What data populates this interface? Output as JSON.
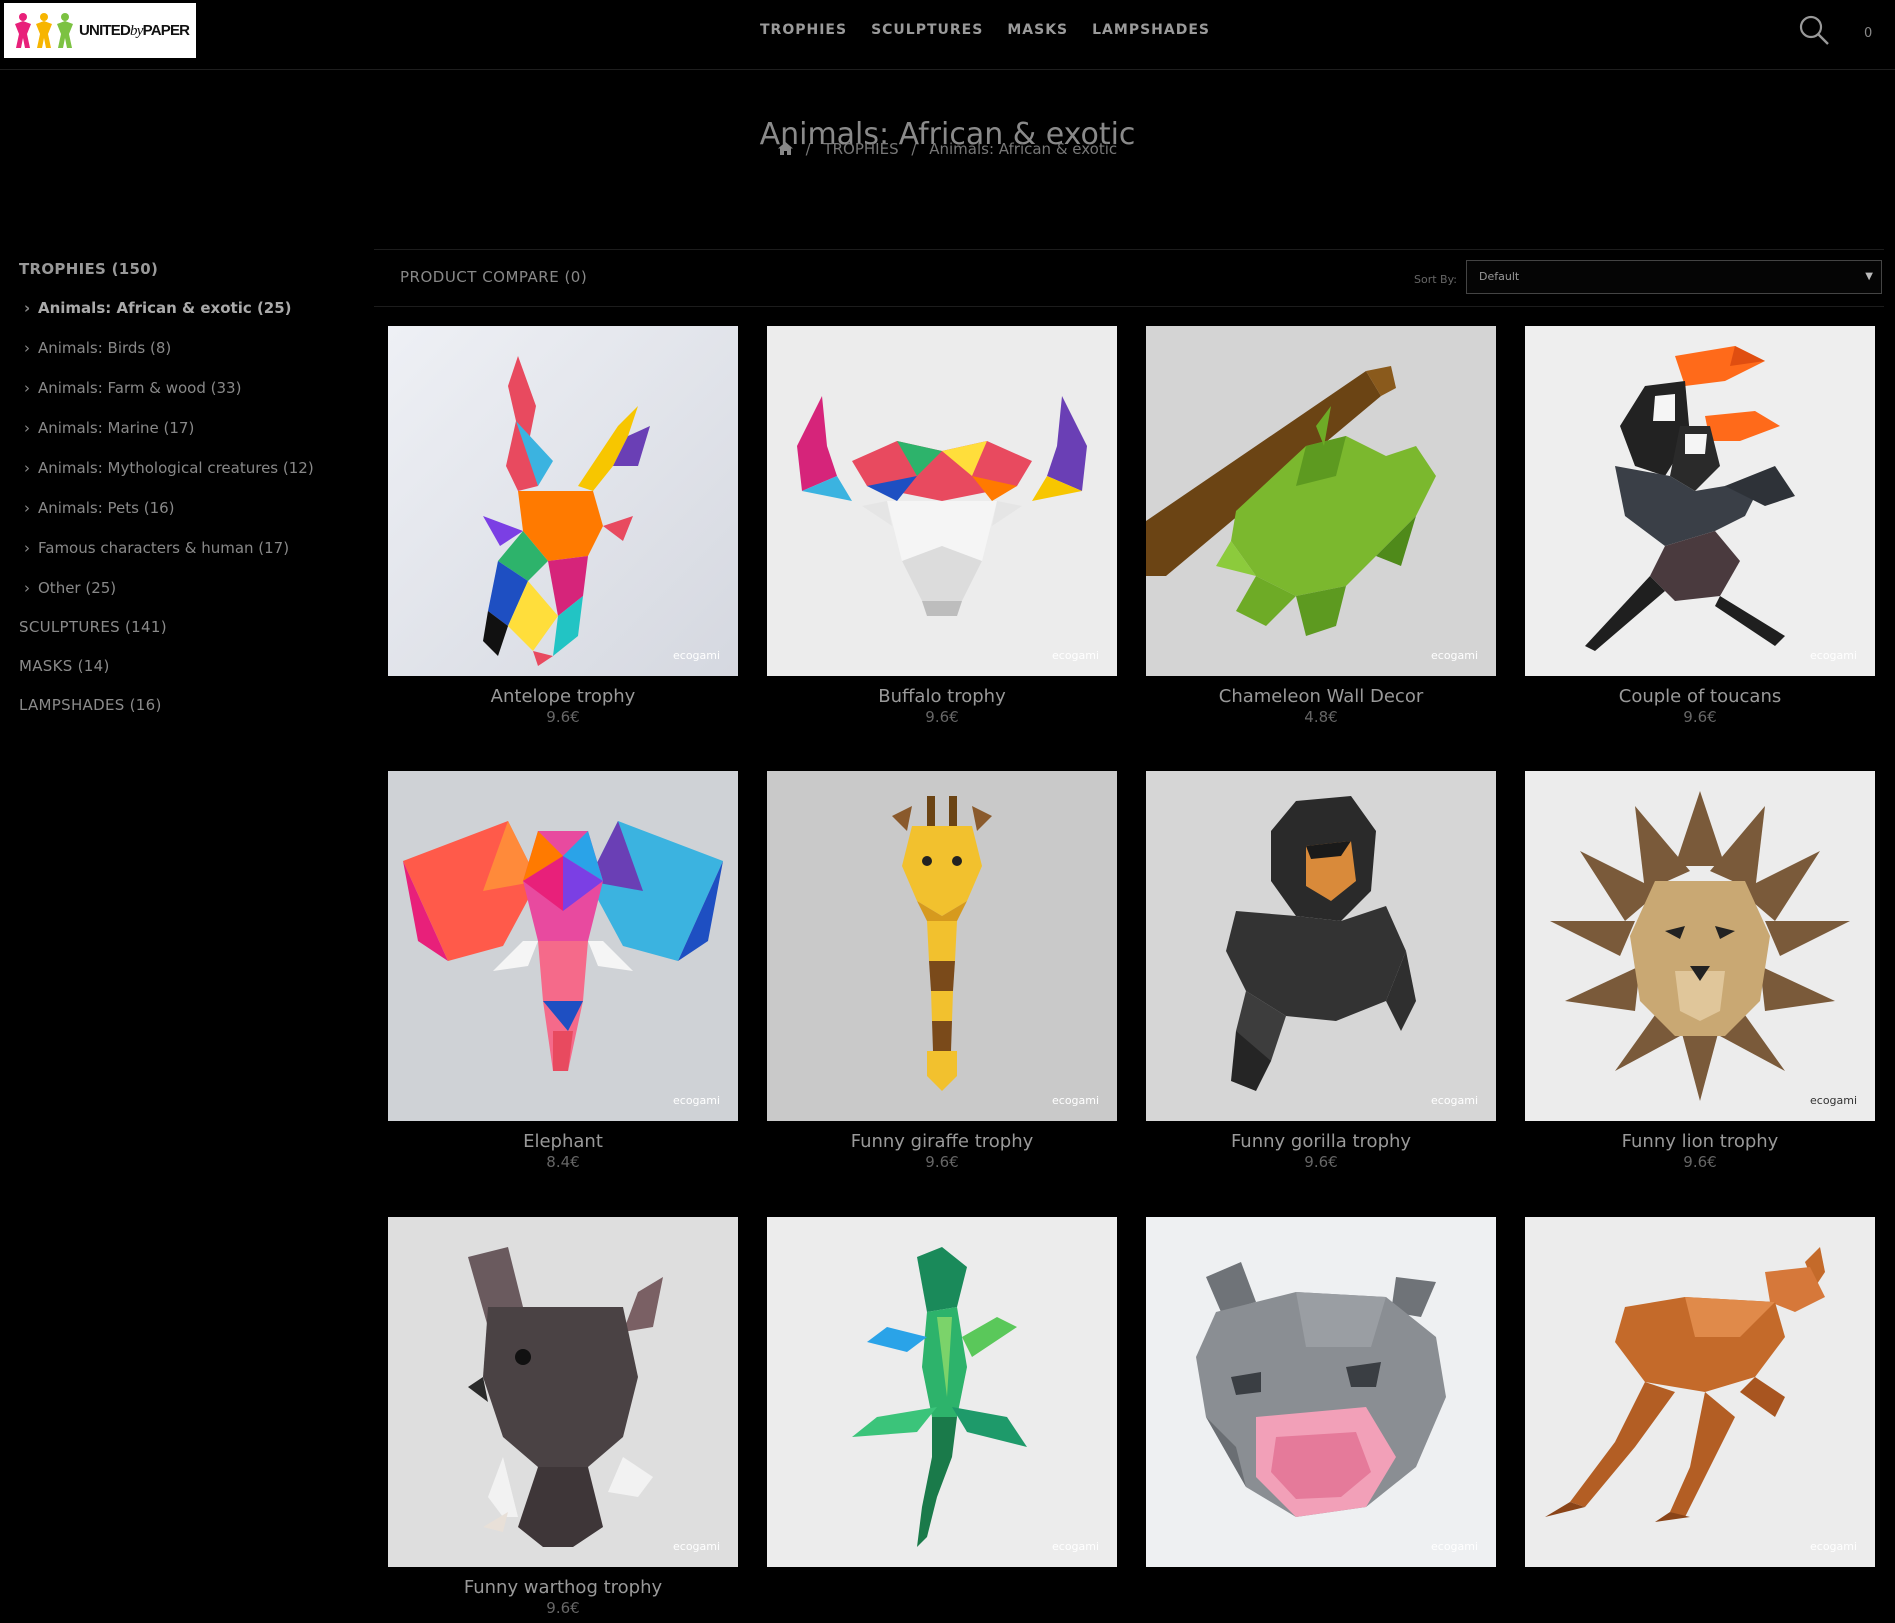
{
  "header": {
    "logo_text_bold": "UNITED",
    "logo_text_italic": "by",
    "logo_text_end": "PAPER",
    "nav": [
      "TROPHIES",
      "SCULPTURES",
      "MASKS",
      "LAMPSHADES"
    ],
    "cart_count": "0"
  },
  "page": {
    "title": "Animals: African & exotic",
    "breadcrumb": [
      "TROPHIES",
      "Animals: African & exotic"
    ]
  },
  "sidebar": {
    "top": [
      {
        "label": "TROPHIES (150)"
      },
      {
        "label": "SCULPTURES (141)"
      },
      {
        "label": "MASKS (14)"
      },
      {
        "label": "LAMPSHADES (16)"
      }
    ],
    "subs": [
      {
        "label": "Animals: African & exotic (25)"
      },
      {
        "label": "Animals: Birds (8)"
      },
      {
        "label": "Animals: Farm & wood (33)"
      },
      {
        "label": "Animals: Marine (17)"
      },
      {
        "label": "Animals: Mythological creatures (12)"
      },
      {
        "label": "Animals: Pets (16)"
      },
      {
        "label": "Famous characters & human (17)"
      },
      {
        "label": "Other (25)"
      }
    ]
  },
  "toolbar": {
    "compare": "PRODUCT COMPARE (0)",
    "sort_label": "Sort By:",
    "sort_value": "Default"
  },
  "watermark": "ecogami",
  "products": [
    {
      "name": "Antelope trophy",
      "price": "9.6€",
      "icon": "antelope"
    },
    {
      "name": "Buffalo trophy",
      "price": "9.6€",
      "icon": "buffalo"
    },
    {
      "name": "Chameleon Wall Decor",
      "price": "4.8€",
      "icon": "chameleon"
    },
    {
      "name": "Couple of toucans",
      "price": "9.6€",
      "icon": "toucans"
    },
    {
      "name": "Elephant",
      "price": "8.4€",
      "icon": "elephant"
    },
    {
      "name": "Funny giraffe trophy",
      "price": "9.6€",
      "icon": "giraffe"
    },
    {
      "name": "Funny gorilla trophy",
      "price": "9.6€",
      "icon": "gorilla"
    },
    {
      "name": "Funny lion trophy",
      "price": "9.6€",
      "icon": "lion"
    },
    {
      "name": "Funny warthog trophy",
      "price": "9.6€",
      "icon": "warthog"
    },
    {
      "name": "",
      "price": "",
      "icon": "gecko"
    },
    {
      "name": "",
      "price": "",
      "icon": "hippo"
    },
    {
      "name": "",
      "price": "",
      "icon": "kangaroo"
    }
  ]
}
